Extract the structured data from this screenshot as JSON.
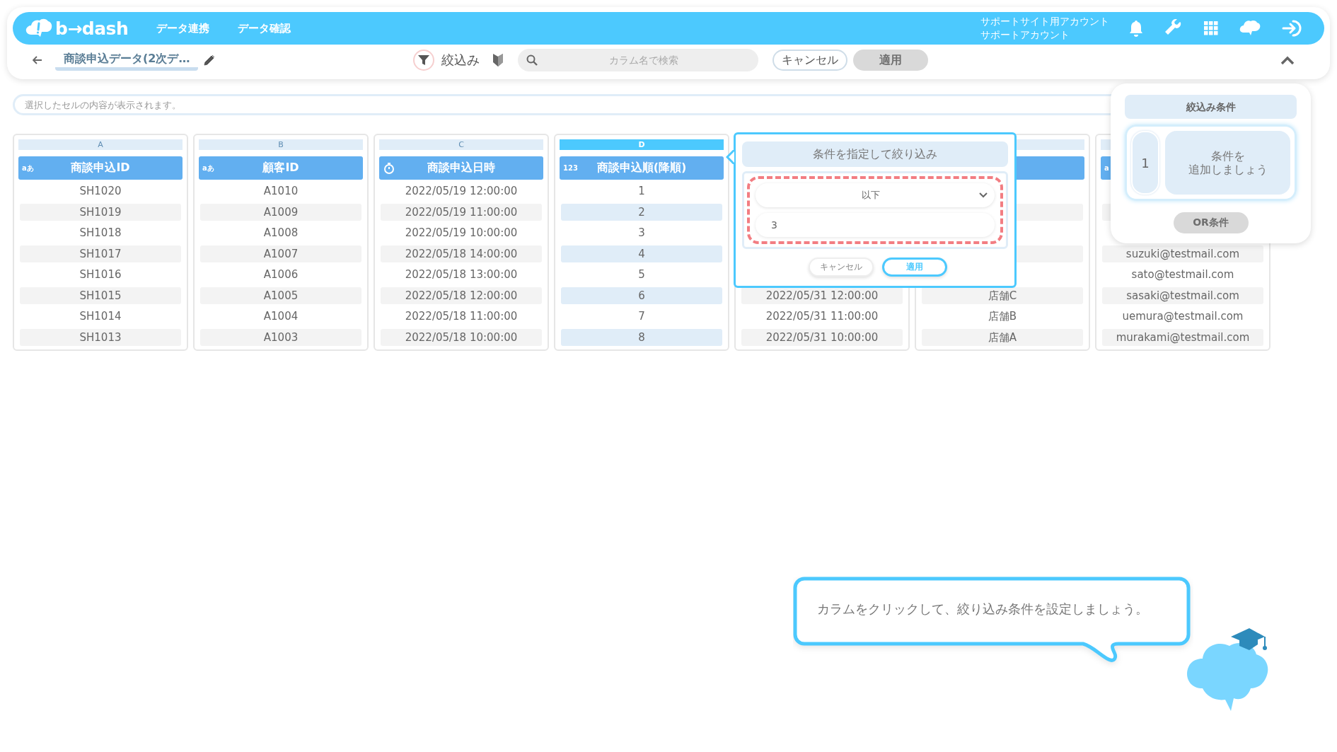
{
  "header": {
    "logo": "b→dash",
    "nav": [
      {
        "label": "データ連携"
      },
      {
        "label": "データ確認"
      }
    ],
    "account": {
      "site": "サポートサイト用アカウント",
      "name": "サポートアカウント"
    }
  },
  "toolbar": {
    "title": "商談申込データ(2次デ…",
    "filter_label": "絞込み",
    "search": {
      "placeholder": "カラム名で検索"
    },
    "buttons": [
      {
        "label": "キャンセル",
        "disabled": false
      },
      {
        "label": "適用",
        "disabled": true
      }
    ]
  },
  "cell_viewer": {
    "placeholder": "選択したセルの内容が表示されます。"
  },
  "table": {
    "columns": [
      {
        "letter": "A",
        "name": "商談申込ID",
        "kind": "text",
        "type_mark": "aあ",
        "selected": false,
        "cells": [
          "SH1020",
          "SH1019",
          "SH1018",
          "SH1017",
          "SH1016",
          "SH1015",
          "SH1014",
          "SH1013"
        ]
      },
      {
        "letter": "B",
        "name": "顧客ID",
        "kind": "text",
        "type_mark": "aあ",
        "selected": false,
        "cells": [
          "A1010",
          "A1009",
          "A1008",
          "A1007",
          "A1006",
          "A1005",
          "A1004",
          "A1003"
        ]
      },
      {
        "letter": "C",
        "name": "商談申込日時",
        "kind": "datetime",
        "selected": false,
        "cells": [
          "2022/05/19 12:00:00",
          "2022/05/19 11:00:00",
          "2022/05/19 10:00:00",
          "2022/05/18 14:00:00",
          "2022/05/18 13:00:00",
          "2022/05/18 12:00:00",
          "2022/05/18 11:00:00",
          "2022/05/18 10:00:00"
        ]
      },
      {
        "letter": "D",
        "name": "商談申込順(降順)",
        "kind": "number",
        "type_mark": "123",
        "selected": true,
        "cells": [
          "1",
          "2",
          "3",
          "4",
          "5",
          "6",
          "7",
          "8"
        ]
      },
      {
        "cells": [
          null,
          null,
          null,
          null,
          null,
          "2022/05/31 12:00:00",
          "2022/05/31 11:00:00",
          "2022/05/31 10:00:00"
        ]
      },
      {
        "selected": false,
        "cells": [
          null,
          null,
          null,
          null,
          null,
          "店舗C",
          "店舗B",
          "店舗A"
        ]
      },
      {
        "kind": "text",
        "type_mark": "a",
        "selected": false,
        "cells": [
          null,
          null,
          null,
          "suzuki@testmail.com",
          "sato@testmail.com",
          "sasaki@testmail.com",
          "uemura@testmail.com",
          "murakami@testmail.com"
        ]
      }
    ]
  },
  "condition_popup": {
    "title": "条件を指定して絞り込み",
    "operator": "以下",
    "value": "3",
    "buttons": [
      {
        "label": "キャンセル",
        "selected": false
      },
      {
        "label": "適用",
        "selected": true
      }
    ]
  },
  "conditions_panel": {
    "title": "絞込み条件",
    "groups": [
      {
        "number": "1",
        "lines": [
          "条件を",
          "追加しましょう"
        ]
      }
    ],
    "or_button": {
      "label": "OR条件",
      "disabled": true
    }
  },
  "hint": {
    "text": "カラムをクリックして、絞り込み条件を設定しましょう。"
  }
}
